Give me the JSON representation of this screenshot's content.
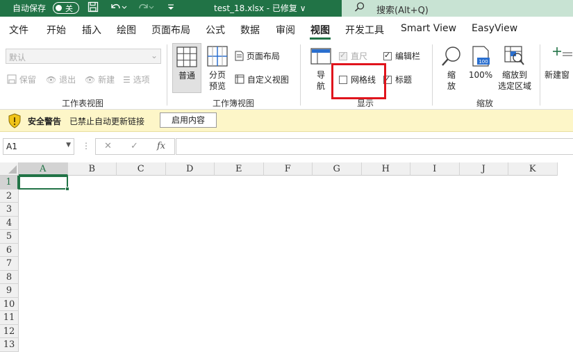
{
  "titlebar": {
    "autosave_label": "自动保存",
    "autosave_state": "关",
    "filename": "test_18.xlsx - 已修复 ∨",
    "search_placeholder": "搜索(Alt+Q)"
  },
  "tabs": [
    {
      "label": "文件"
    },
    {
      "label": "开始"
    },
    {
      "label": "插入"
    },
    {
      "label": "绘图"
    },
    {
      "label": "页面布局"
    },
    {
      "label": "公式"
    },
    {
      "label": "数据"
    },
    {
      "label": "审阅"
    },
    {
      "label": "视图"
    },
    {
      "label": "开发工具"
    },
    {
      "label": "Smart View"
    },
    {
      "label": "EasyView"
    }
  ],
  "ribbon": {
    "sheet_view": {
      "dropdown_value": "默认",
      "keep": "保留",
      "exit": "退出",
      "new": "新建",
      "options": "选项",
      "group_label": "工作表视图"
    },
    "workbook_views": {
      "normal": "普通",
      "page_break_1": "分页",
      "page_break_2": "预览",
      "page_layout": "页面布局",
      "custom_views": "自定义视图",
      "group_label": "工作簿视图"
    },
    "show": {
      "navigation_1": "导",
      "navigation_2": "航",
      "ruler": "直尺",
      "formula_bar": "编辑栏",
      "gridlines": "网格线",
      "headings": "标题",
      "group_label": "显示"
    },
    "zoom": {
      "zoom_1": "缩",
      "zoom_2": "放",
      "hundred": "100%",
      "zoom_sel_1": "缩放到",
      "zoom_sel_2": "选定区域",
      "group_label": "缩放"
    },
    "window": {
      "new_window": "新建窗"
    }
  },
  "security": {
    "title": "安全警告",
    "message": "已禁止自动更新链接",
    "button": "启用内容"
  },
  "formula": {
    "namebox": "A1",
    "fx": "fx"
  },
  "columns": [
    "A",
    "B",
    "C",
    "D",
    "E",
    "F",
    "G",
    "H",
    "I",
    "J",
    "K"
  ],
  "rows": [
    "1",
    "2",
    "3",
    "4",
    "5",
    "6",
    "7",
    "8",
    "9",
    "10",
    "11",
    "12",
    "13"
  ],
  "colors": {
    "accent": "#217346",
    "highlight": "#e0141c",
    "warning_bg": "#fdf6c8"
  }
}
